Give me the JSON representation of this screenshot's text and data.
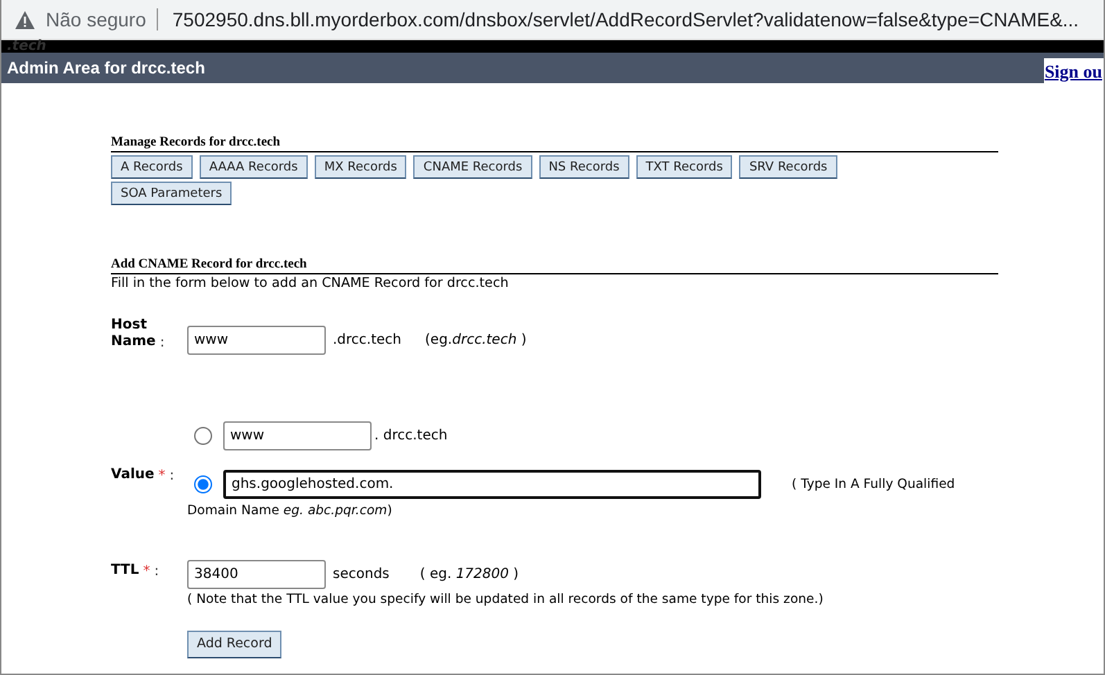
{
  "browser": {
    "security": "Não seguro",
    "url": "7502950.dns.bll.myorderbox.com/dnsbox/servlet/AddRecordServlet?validatenow=false&type=CNAME&..."
  },
  "logo": ".tech",
  "header": {
    "title": "Admin Area for drcc.tech",
    "link": "Sign ou"
  },
  "manage": {
    "heading": "Manage Records for drcc.tech",
    "buttons": [
      {
        "label": "A Records"
      },
      {
        "label": "AAAA Records"
      },
      {
        "label": "MX Records"
      },
      {
        "label": "CNAME Records"
      },
      {
        "label": "NS Records"
      },
      {
        "label": "TXT Records"
      },
      {
        "label": "SRV Records"
      },
      {
        "label": "SOA Parameters"
      }
    ]
  },
  "form": {
    "heading": "Add CNAME Record for drcc.tech",
    "description": "Fill in the form below to add an CNAME Record for drcc.tech",
    "host": {
      "label_lines": [
        "Host",
        "Name"
      ],
      "colon": ":",
      "value": "www",
      "suffix": ".drcc.tech",
      "example": "(eg.*drcc.tech* )"
    },
    "value": {
      "label": "Value",
      "required_mark": "*",
      "colon": ":",
      "options": [
        {
          "kind": "subdomain",
          "selected": false,
          "value": "www",
          "suffix": ". drcc.tech"
        },
        {
          "kind": "fqdn",
          "selected": true,
          "value": "ghs.googlehosted.com.",
          "hint": "( Type In A Fully Qualified",
          "hint_more": "Domain Name *eg. abc.pqr.com*)"
        }
      ]
    },
    "ttl": {
      "label": "TTL",
      "required_mark": "*",
      "colon": ":",
      "value": "38400",
      "unit": "seconds",
      "example": "( eg. *172800* )",
      "note": "( Note that the TTL value you specify will be updated in all records of the same type for this zone.)"
    },
    "submit": "Add Record"
  }
}
